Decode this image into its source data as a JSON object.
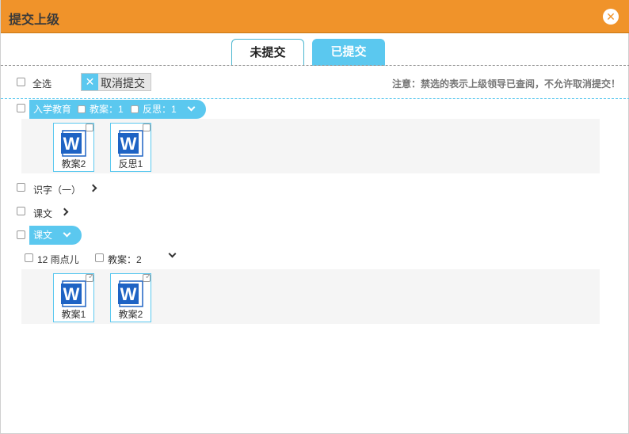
{
  "dialog": {
    "title": "提交上级",
    "close_icon": "close-icon"
  },
  "tabs": [
    {
      "label": "未提交",
      "active": false
    },
    {
      "label": "已提交",
      "active": true
    }
  ],
  "toolbar": {
    "select_all_label": "全选",
    "cancel_submit_label": "取消提交",
    "notice": "注意：禁选的表示上级领导已查阅，不允许取消提交！"
  },
  "groups": [
    {
      "title": "入学教育",
      "lesson_plan_label": "教案：1",
      "reflection_label": "反思：1",
      "expanded": true,
      "files": [
        {
          "name": "教案2",
          "type": "word",
          "checked": false
        },
        {
          "name": "反思1",
          "type": "word",
          "checked": false
        }
      ]
    },
    {
      "title": "识字（一）",
      "expanded": false
    },
    {
      "title": "课文",
      "expanded": false
    },
    {
      "title": "课文",
      "expanded": true,
      "subgroup": {
        "title": "12 雨点儿",
        "lesson_plan_label": "教案：2"
      },
      "files": [
        {
          "name": "教案1",
          "type": "word",
          "checked": true
        },
        {
          "name": "教案2",
          "type": "word",
          "checked": true
        }
      ]
    }
  ],
  "colors": {
    "titlebar": "#f0932a",
    "accent": "#5bc8ef",
    "word_blue": "#1e63c4"
  }
}
